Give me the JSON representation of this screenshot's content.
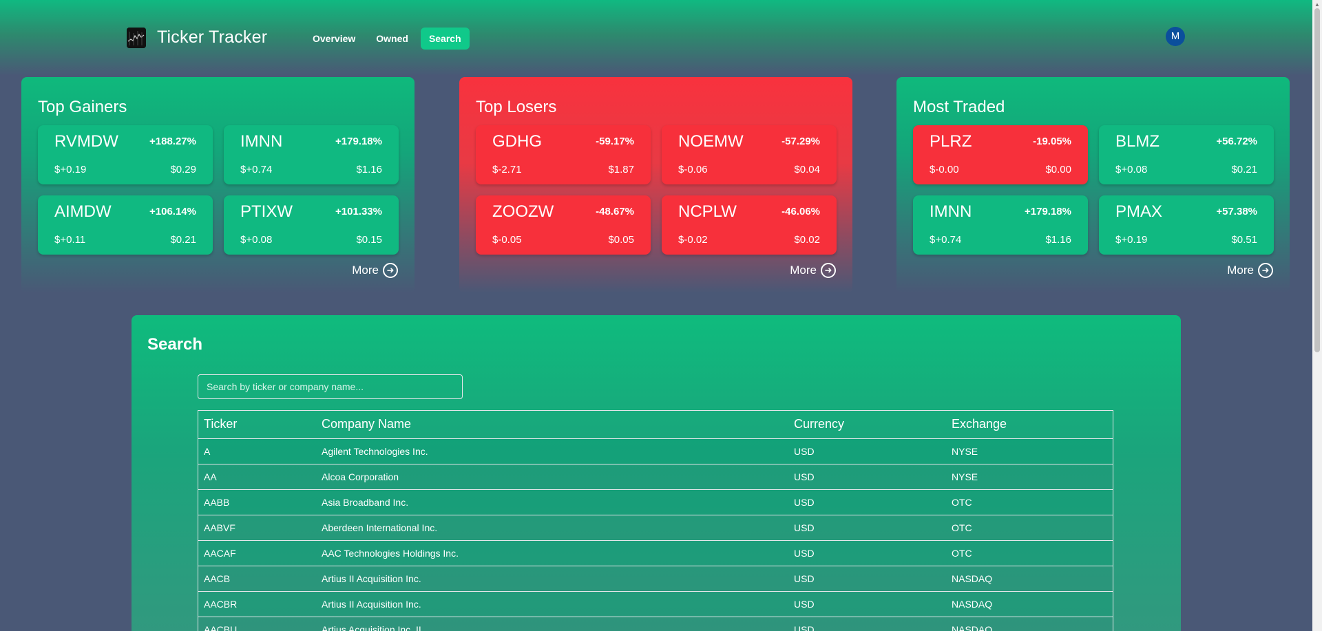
{
  "app": {
    "title": "Ticker Tracker",
    "avatar_initial": "M"
  },
  "nav": {
    "items": [
      {
        "label": "Overview",
        "active": false
      },
      {
        "label": "Owned",
        "active": false
      },
      {
        "label": "Search",
        "active": true
      }
    ]
  },
  "panels": [
    {
      "title": "Top Gainers",
      "theme": "green",
      "more_label": "More",
      "cards": [
        {
          "ticker": "RVMDW",
          "percent": "+188.27%",
          "change": "$+0.19",
          "price": "$0.29",
          "direction": "up"
        },
        {
          "ticker": "IMNN",
          "percent": "+179.18%",
          "change": "$+0.74",
          "price": "$1.16",
          "direction": "up"
        },
        {
          "ticker": "AIMDW",
          "percent": "+106.14%",
          "change": "$+0.11",
          "price": "$0.21",
          "direction": "up"
        },
        {
          "ticker": "PTIXW",
          "percent": "+101.33%",
          "change": "$+0.08",
          "price": "$0.15",
          "direction": "up"
        }
      ]
    },
    {
      "title": "Top Losers",
      "theme": "red",
      "more_label": "More",
      "cards": [
        {
          "ticker": "GDHG",
          "percent": "-59.17%",
          "change": "$-2.71",
          "price": "$1.87",
          "direction": "down"
        },
        {
          "ticker": "NOEMW",
          "percent": "-57.29%",
          "change": "$-0.06",
          "price": "$0.04",
          "direction": "down"
        },
        {
          "ticker": "ZOOZW",
          "percent": "-48.67%",
          "change": "$-0.05",
          "price": "$0.05",
          "direction": "down"
        },
        {
          "ticker": "NCPLW",
          "percent": "-46.06%",
          "change": "$-0.02",
          "price": "$0.02",
          "direction": "down"
        }
      ]
    },
    {
      "title": "Most Traded",
      "theme": "green",
      "more_label": "More",
      "cards": [
        {
          "ticker": "PLRZ",
          "percent": "-19.05%",
          "change": "$-0.00",
          "price": "$0.00",
          "direction": "down"
        },
        {
          "ticker": "BLMZ",
          "percent": "+56.72%",
          "change": "$+0.08",
          "price": "$0.21",
          "direction": "up"
        },
        {
          "ticker": "IMNN",
          "percent": "+179.18%",
          "change": "$+0.74",
          "price": "$1.16",
          "direction": "up"
        },
        {
          "ticker": "PMAX",
          "percent": "+57.38%",
          "change": "$+0.19",
          "price": "$0.51",
          "direction": "up"
        }
      ]
    }
  ],
  "search": {
    "title": "Search",
    "placeholder": "Search by ticker or company name...",
    "columns": [
      "Ticker",
      "Company Name",
      "Currency",
      "Exchange"
    ],
    "rows": [
      [
        "A",
        "Agilent Technologies Inc.",
        "USD",
        "NYSE"
      ],
      [
        "AA",
        "Alcoa Corporation",
        "USD",
        "NYSE"
      ],
      [
        "AABB",
        "Asia Broadband Inc.",
        "USD",
        "OTC"
      ],
      [
        "AABVF",
        "Aberdeen International Inc.",
        "USD",
        "OTC"
      ],
      [
        "AACAF",
        "AAC Technologies Holdings Inc.",
        "USD",
        "OTC"
      ],
      [
        "AACB",
        "Artius II Acquisition Inc.",
        "USD",
        "NASDAQ"
      ],
      [
        "AACBR",
        "Artius II Acquisition Inc.",
        "USD",
        "NASDAQ"
      ],
      [
        "AACBU",
        "Artius Acquisition Inc. II",
        "USD",
        "NASDAQ"
      ]
    ]
  },
  "colors": {
    "green": "#10b981",
    "red": "#f7303b",
    "background": "#4a5876",
    "avatar": "#0b4f9c"
  }
}
